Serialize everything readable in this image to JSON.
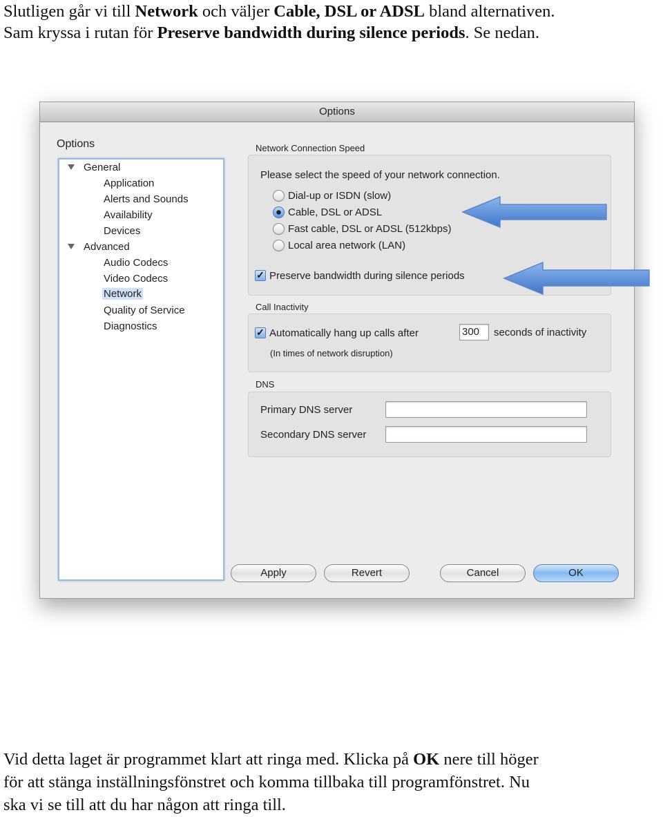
{
  "intro": {
    "line1": [
      {
        "t": "Slutligen går vi till ",
        "b": false
      },
      {
        "t": "Network",
        "b": true
      },
      {
        "t": " och väljer ",
        "b": false
      },
      {
        "t": "Cable, DSL or ADSL",
        "b": true
      },
      {
        "t": " bland alternativen.",
        "b": false
      }
    ],
    "line2": [
      {
        "t": "Sam kryssa i rutan för ",
        "b": false
      },
      {
        "t": "Preserve bandwidth during silence periods",
        "b": true
      },
      {
        "t": ". Se nedan.",
        "b": false
      }
    ]
  },
  "dialog": {
    "title": "Options",
    "sidebar_label": "Options",
    "tree": {
      "general": "General",
      "general_items": [
        "Application",
        "Alerts and Sounds",
        "Availability",
        "Devices"
      ],
      "advanced": "Advanced",
      "advanced_items": [
        "Audio Codecs",
        "Video Codecs",
        "Network",
        "Quality of Service",
        "Diagnostics"
      ],
      "selected": "Network"
    },
    "network_speed": {
      "label": "Network Connection Speed",
      "prompt": "Please select the speed of your network connection.",
      "options": [
        "Dial-up or ISDN (slow)",
        "Cable, DSL or ADSL",
        "Fast cable, DSL or ADSL (512kbps)",
        "Local area network (LAN)"
      ],
      "selected_index": 1,
      "preserve_label": "Preserve bandwidth during silence periods",
      "preserve_checked": true
    },
    "call_inactivity": {
      "label": "Call Inactivity",
      "hangup_label": "Automatically hang up calls after",
      "hangup_checked": true,
      "seconds_value": "300",
      "seconds_suffix": "seconds of inactivity",
      "note": "(In times of network disruption)"
    },
    "dns": {
      "label": "DNS",
      "primary_label": "Primary DNS server",
      "primary_value": "",
      "secondary_label": "Secondary DNS server",
      "secondary_value": ""
    },
    "buttons": {
      "apply": "Apply",
      "revert": "Revert",
      "cancel": "Cancel",
      "ok": "OK"
    }
  },
  "outro": {
    "line1": [
      {
        "t": "Vid detta laget är programmet klart att ringa med. Klicka på ",
        "b": false
      },
      {
        "t": "OK",
        "b": true
      },
      {
        "t": " nere till höger",
        "b": false
      }
    ],
    "line2": "för att stänga inställningsfönstret och komma tillbaka till programfönstret. Nu",
    "line3": "ska vi se till att du har någon att ringa till."
  },
  "colors": {
    "arrow": "#4f86d6",
    "selection": "#cfe0f7",
    "default_button": "#84b8ef"
  }
}
